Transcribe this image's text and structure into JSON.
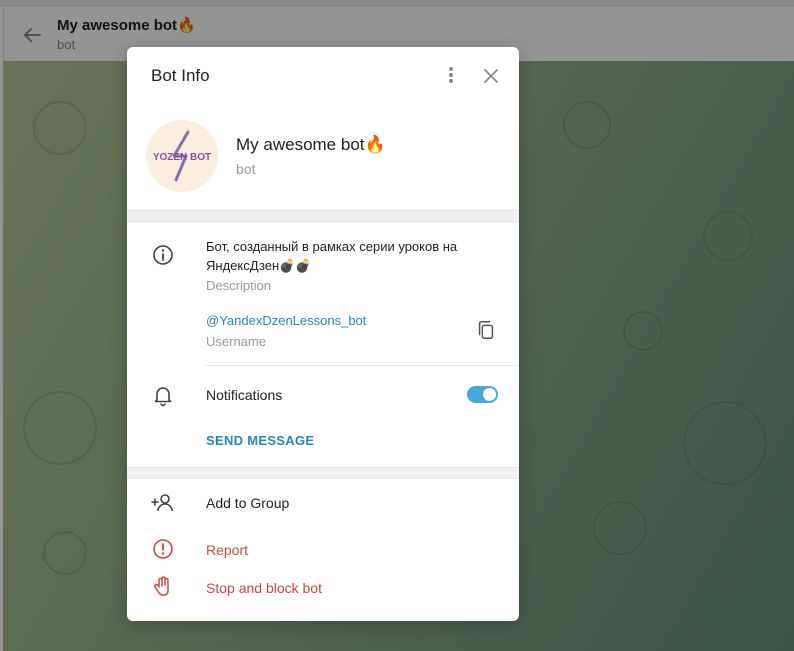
{
  "chat_header": {
    "title": "My awesome bot🔥",
    "subtitle": "bot"
  },
  "modal": {
    "title": "Bot Info",
    "bot_name": "My awesome bot🔥",
    "bot_kind": "bot",
    "avatar_text": "YOZEN BOT",
    "description_text": "Бот, созданный в рамках серии уроков на ЯндексДзен💣💣",
    "description_label": "Description",
    "username_value": "@YandexDzenLessons_bot",
    "username_label": "Username",
    "notifications_label": "Notifications",
    "notifications_enabled": true,
    "send_message_label": "SEND MESSAGE",
    "add_to_group_label": "Add to Group",
    "report_label": "Report",
    "stop_block_label": "Stop and block bot"
  },
  "colors": {
    "accent": "#48a7e0",
    "link": "#2a86c2",
    "danger": "#d24545"
  },
  "icons": [
    "back-arrow-icon",
    "more-vertical-icon",
    "close-icon",
    "info-icon",
    "copy-icon",
    "bell-icon",
    "add-user-icon",
    "report-icon",
    "stop-hand-icon"
  ]
}
